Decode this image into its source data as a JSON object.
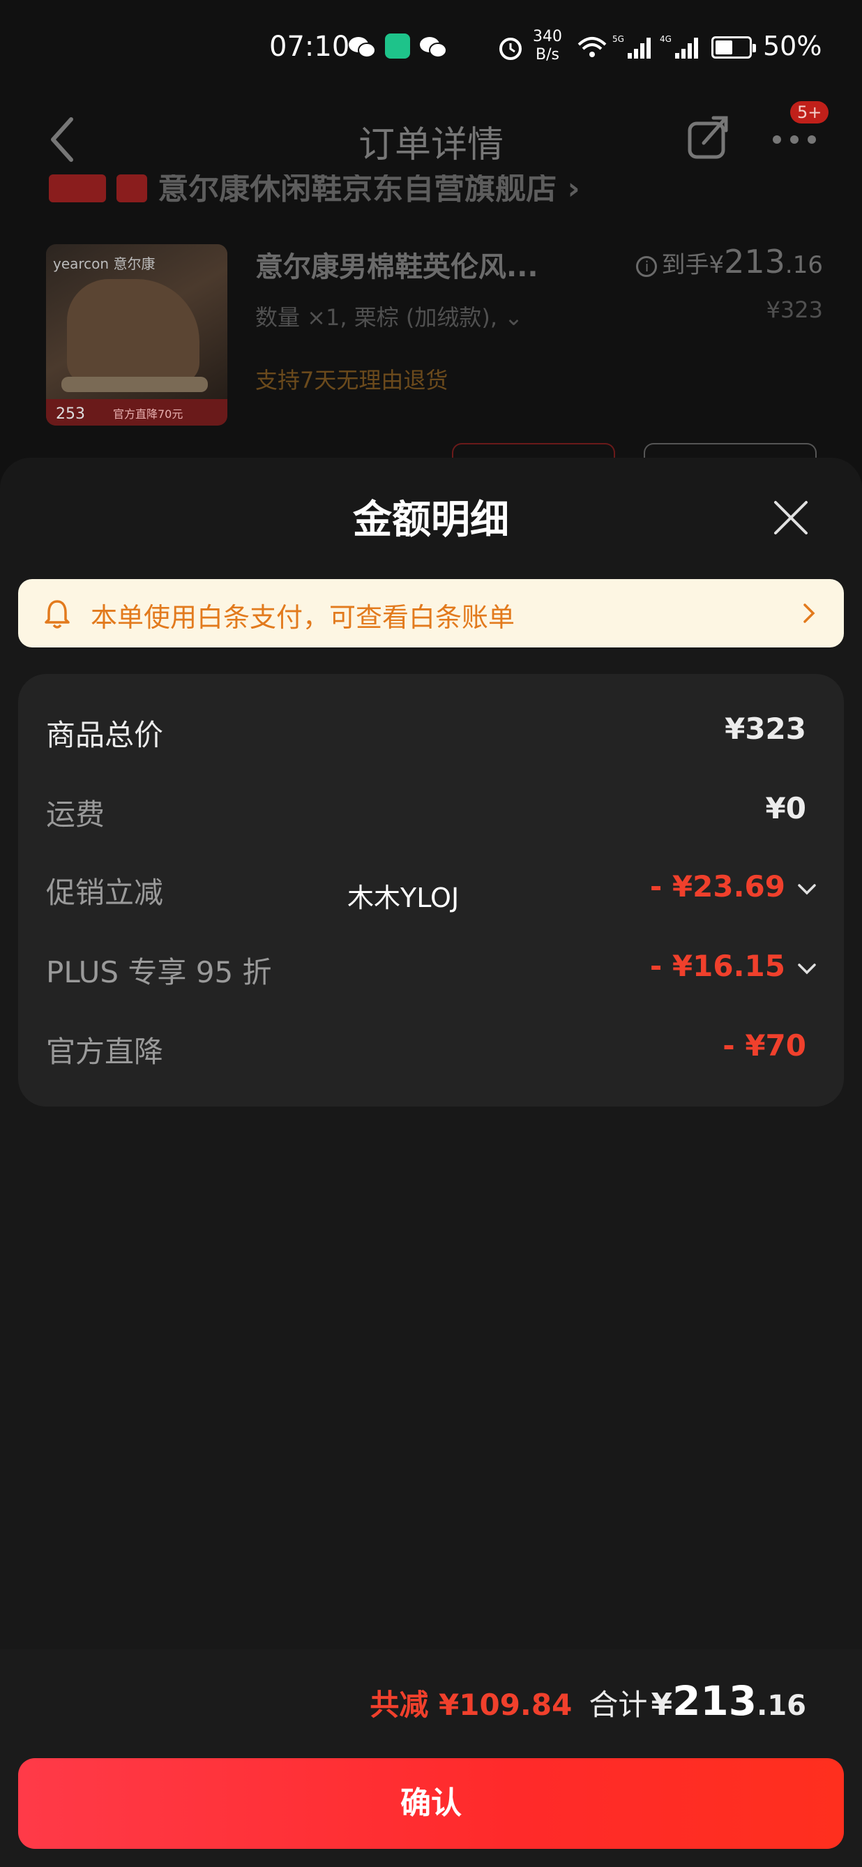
{
  "status_bar": {
    "time": "07:10",
    "net_speed_value": "340",
    "net_speed_unit": "B/s",
    "battery": "50%"
  },
  "nav": {
    "title": "订单详情",
    "badge": "5+"
  },
  "shop": {
    "name": "意尔康休闲鞋京东自营旗舰店 ›"
  },
  "product": {
    "brand": "yearcon 意尔康",
    "title": "意尔康男棉鞋英伦风...",
    "spec": "数量 ×1, 栗棕 (加绒款), ⌄",
    "return_policy": "支持7天无理由退货",
    "price_prefix": "到手¥",
    "price_int": "213",
    "price_dec": ".16",
    "original_price": "¥323",
    "strip_price": "253",
    "strip_text": "官方直降70元"
  },
  "sheet": {
    "title": "金额明细",
    "notice": "本单使用白条支付，可查看白条账单",
    "rows": [
      {
        "label": "商品总价",
        "value": "¥323"
      },
      {
        "label": "运费",
        "value": "¥0"
      },
      {
        "label": "促销立减",
        "value": "- ¥23.69"
      },
      {
        "label": "PLUS 专享 95 折",
        "value": "- ¥16.15"
      },
      {
        "label": "官方直降",
        "value": "- ¥70"
      }
    ],
    "watermark": "木木YLOJ"
  },
  "footer": {
    "saved": "共减 ¥109.84",
    "total_label": "合计",
    "total_currency": "¥",
    "total_int": "213",
    "total_dec": ".16",
    "confirm_label": "确认"
  },
  "colors": {
    "accent_red": "#f0402c",
    "notice_bg": "#fdf6e3",
    "notice_text": "#e27a1d"
  },
  "icons": [
    "back-icon",
    "share-icon",
    "more-icon",
    "close-icon",
    "bell-icon",
    "chevron-right-icon",
    "chevron-down-icon",
    "info-icon"
  ]
}
